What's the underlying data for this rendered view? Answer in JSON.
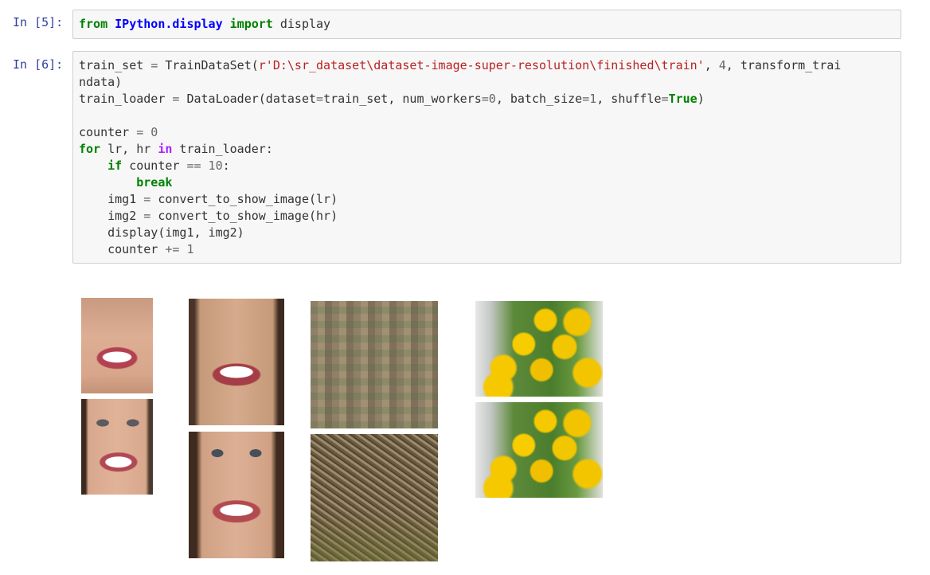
{
  "cells": [
    {
      "prompt": "In [5]:"
    },
    {
      "prompt": "In [6]:"
    }
  ],
  "code5": {
    "kw_from": "from",
    "module": "IPython.display",
    "kw_import": "import",
    "name": " display"
  },
  "code6": {
    "l1a": "train_set ",
    "l1eq": "=",
    "l1b": " TrainDataSet(",
    "l1str": "r'D:\\sr_dataset\\dataset-image-super-resolution\\finished\\train'",
    "l1c": ", ",
    "l1num": "4",
    "l1d": ", transform_trai",
    "l2": "ndata)",
    "l3a": "train_loader ",
    "l3eq": "=",
    "l3b": " DataLoader(dataset",
    "l3eq2": "=",
    "l3c": "train_set, num_workers",
    "l3eq3": "=",
    "l3num": "0",
    "l3d": ", batch_size",
    "l3eq4": "=",
    "l3num2": "1",
    "l3e": ", shuffle",
    "l3eq5": "=",
    "l3true": "True",
    "l3f": ")",
    "l5a": "counter ",
    "l5eq": "=",
    "l5num": " 0",
    "l6for": "for",
    "l6a": " lr, hr ",
    "l6in": "in",
    "l6b": " train_loader:",
    "l7if": "if",
    "l7a": " counter ",
    "l7eq": "==",
    "l7num": " 10",
    "l7b": ":",
    "l8break": "break",
    "l9a": "img1 ",
    "l9eq": "=",
    "l9b": " convert_to_show_image(lr)",
    "l10a": "img2 ",
    "l10eq": "=",
    "l10b": " convert_to_show_image(hr)",
    "l11": "display(img1, img2)",
    "l12a": "counter ",
    "l12eq": "+=",
    "l12num": " 1"
  },
  "colors": {
    "prompt": "#303f9f",
    "keyword": "#008000",
    "keyword_in": "#aa22ff",
    "module": "#0000ff",
    "string": "#ba2121",
    "number": "#666666"
  }
}
